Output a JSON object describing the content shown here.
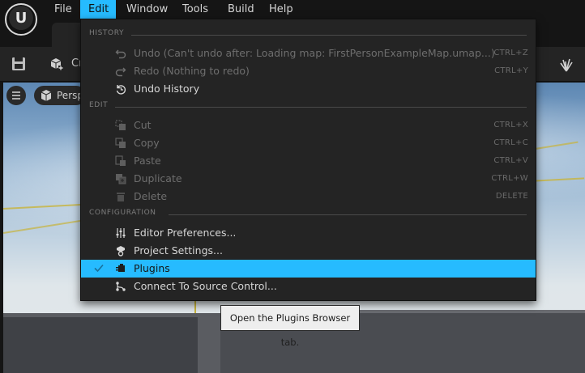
{
  "menubar": {
    "logo_icon": "unreal-engine-logo-icon",
    "items": [
      {
        "label": "File",
        "active": false
      },
      {
        "label": "Edit",
        "active": true
      },
      {
        "label": "Window",
        "active": false
      },
      {
        "label": "Tools",
        "active": false
      },
      {
        "label": "Build",
        "active": false
      },
      {
        "label": "Help",
        "active": false
      }
    ]
  },
  "toolbar": {
    "create_label": "Cr",
    "save_icon": "save-icon",
    "create_icon": "create-cube-icon",
    "right_icon": "foliage-icon"
  },
  "viewport": {
    "perspective_label": "Persp",
    "menu_icon": "hamburger-icon",
    "perspective_icon": "cube-icon"
  },
  "edit_menu": {
    "sections": {
      "history": "HISTORY",
      "edit": "EDIT",
      "configuration": "CONFIGURATION"
    },
    "history": [
      {
        "label": "Undo (Can't undo after: Loading map: FirstPersonExampleMap.umap...)",
        "shortcut": "CTRL+Z",
        "icon": "undo-icon",
        "enabled": false
      },
      {
        "label": "Redo (Nothing to redo)",
        "shortcut": "CTRL+Y",
        "icon": "redo-icon",
        "enabled": false
      },
      {
        "label": "Undo History",
        "shortcut": "",
        "icon": "undo-history-icon",
        "enabled": true
      }
    ],
    "edit": [
      {
        "label": "Cut",
        "shortcut": "CTRL+X",
        "icon": "cut-icon",
        "enabled": false
      },
      {
        "label": "Copy",
        "shortcut": "CTRL+C",
        "icon": "copy-icon",
        "enabled": false
      },
      {
        "label": "Paste",
        "shortcut": "CTRL+V",
        "icon": "paste-icon",
        "enabled": false
      },
      {
        "label": "Duplicate",
        "shortcut": "CTRL+W",
        "icon": "duplicate-icon",
        "enabled": false
      },
      {
        "label": "Delete",
        "shortcut": "DELETE",
        "icon": "delete-icon",
        "enabled": false
      }
    ],
    "configuration": [
      {
        "label": "Editor Preferences...",
        "icon": "sliders-icon",
        "enabled": true
      },
      {
        "label": "Project Settings...",
        "icon": "project-settings-icon",
        "enabled": true
      },
      {
        "label": "Plugins",
        "icon": "plugin-icon",
        "enabled": true,
        "highlighted": true,
        "checked": true
      },
      {
        "label": "Connect To Source Control...",
        "icon": "source-control-icon",
        "enabled": true
      }
    ]
  },
  "tooltip": {
    "text": "Open the Plugins Browser tab."
  },
  "colors": {
    "accent": "#26bbff",
    "menu_bg": "#242424",
    "app_bg": "#151515"
  }
}
